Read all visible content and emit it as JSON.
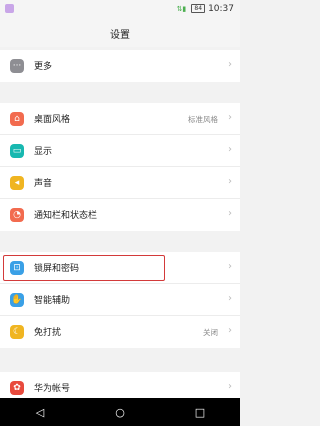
{
  "status_bar": {
    "battery": "84",
    "time": "10:37",
    "signal_icon": "signal-icon"
  },
  "header": {
    "title": "设置"
  },
  "sections": [
    {
      "items": [
        {
          "label": "更多",
          "value": "",
          "icon": "more-icon",
          "color": "#8e8e93"
        }
      ]
    },
    {
      "items": [
        {
          "label": "桌面风格",
          "value": "标准风格",
          "icon": "home-icon",
          "color": "#f26b4f"
        },
        {
          "label": "显示",
          "value": "",
          "icon": "display-icon",
          "color": "#18b8b0"
        },
        {
          "label": "声音",
          "value": "",
          "icon": "sound-icon",
          "color": "#f0b521"
        },
        {
          "label": "通知栏和状态栏",
          "value": "",
          "icon": "notification-icon",
          "color": "#f26b4f"
        }
      ]
    },
    {
      "items": [
        {
          "label": "锁屏和密码",
          "value": "",
          "icon": "lock-icon",
          "color": "#3aa0e6"
        },
        {
          "label": "智能辅助",
          "value": "",
          "icon": "hand-icon",
          "color": "#3aa0e6"
        },
        {
          "label": "免打扰",
          "value": "关闭",
          "icon": "moon-icon",
          "color": "#f0b521"
        }
      ]
    },
    {
      "items": [
        {
          "label": "华为帐号",
          "value": "",
          "icon": "huawei-icon",
          "color": "#e84a3d"
        }
      ]
    }
  ],
  "nav_bar": {
    "back": "back-icon",
    "home": "home-circle-icon",
    "recents": "recents-icon"
  }
}
